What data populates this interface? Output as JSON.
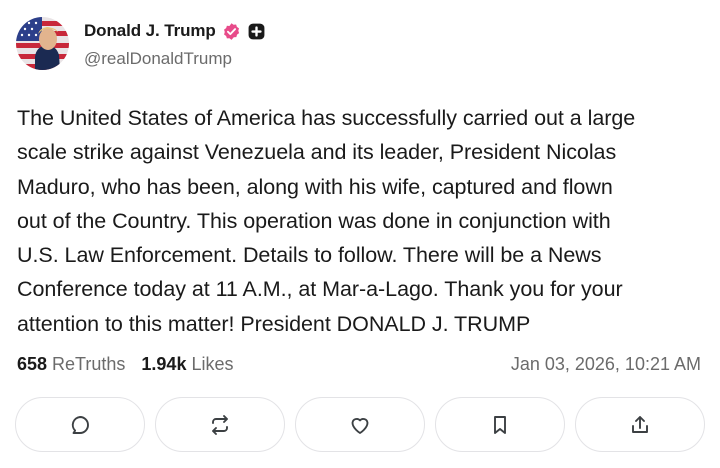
{
  "header": {
    "display_name": "Donald J. Trump",
    "handle": "@realDonaldTrump",
    "avatar_icon": "avatar-portrait-icon",
    "verified_icon": "verified-badge-icon",
    "plus_icon": "plus-badge-icon",
    "verified_color": "#e84b8a"
  },
  "post": {
    "text": "The United States of America has successfully carried out a large\nscale strike against Venezuela and its leader, President Nicolas\nMaduro, who has been, along with his wife, captured and flown\nout of the Country. This operation was done in conjunction with\nU.S. Law Enforcement. Details to follow. There will be a News\nConference today at 11 A.M., at Mar-a-Lago. Thank you for your\nattention to this matter! President DONALD J. TRUMP"
  },
  "stats": {
    "retruths_count": "658",
    "retruths_label": "ReTruths",
    "likes_count": "1.94k",
    "likes_label": "Likes",
    "timestamp": "Jan 03, 2026, 10:21 AM"
  },
  "actions": [
    {
      "icon": "reply-icon"
    },
    {
      "icon": "retruth-icon"
    },
    {
      "icon": "like-heart-icon"
    },
    {
      "icon": "bookmark-icon"
    },
    {
      "icon": "share-icon"
    }
  ]
}
